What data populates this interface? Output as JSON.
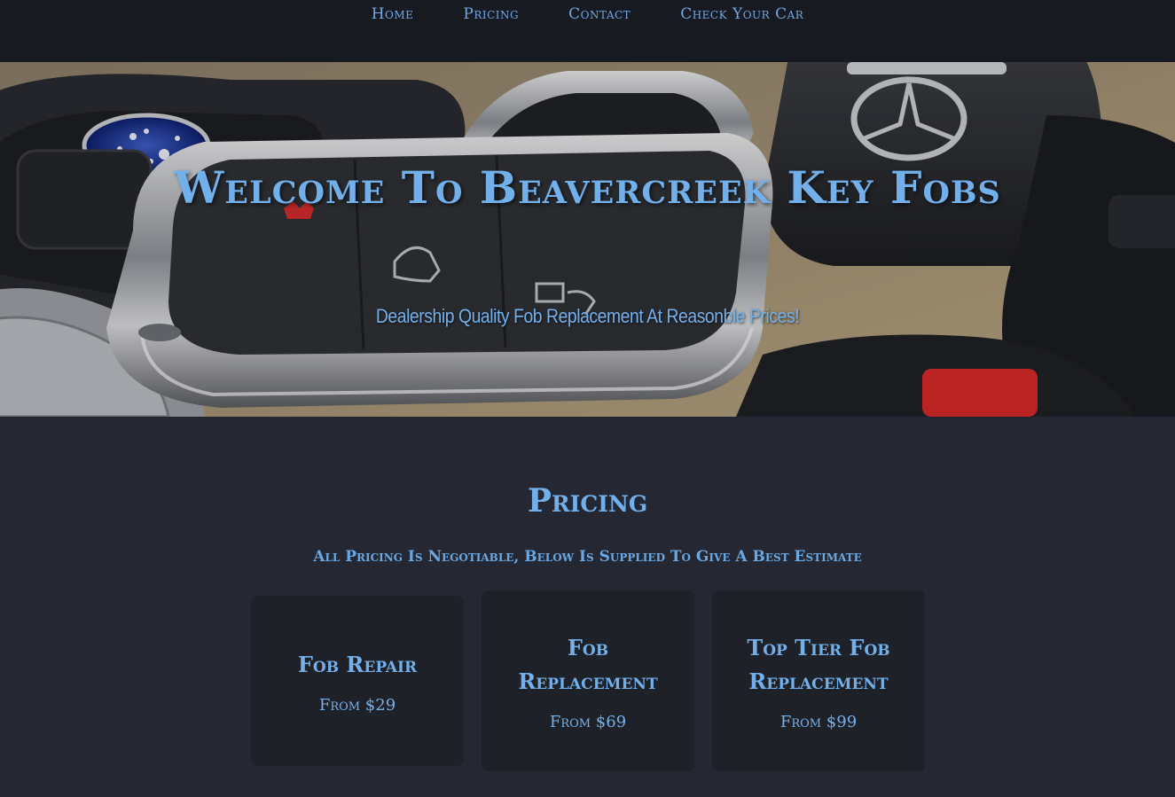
{
  "nav": {
    "items": [
      {
        "label": "Home"
      },
      {
        "label": "Pricing"
      },
      {
        "label": "Contact"
      },
      {
        "label": "Check Your Car"
      }
    ]
  },
  "hero": {
    "title": "Welcome To Beavercreek Key Fobs",
    "subtitle": "Dealership Quality Fob Replacement At Reasonble Prices!"
  },
  "pricing": {
    "title": "Pricing",
    "subtitle": "All Pricing Is Negotiable, Below Is Supplied To Give A Best Estimate",
    "cards": [
      {
        "title": "Fob Repair",
        "price": "From $29"
      },
      {
        "title": "Fob Replacement",
        "price": "From $69"
      },
      {
        "title": "Top Tier Fob Replacement",
        "price": "From $99"
      }
    ]
  },
  "colors": {
    "accent": "#72b0ec",
    "nav_bg": "#181a21",
    "page_bg": "#252832",
    "card_bg": "#1f2129"
  }
}
